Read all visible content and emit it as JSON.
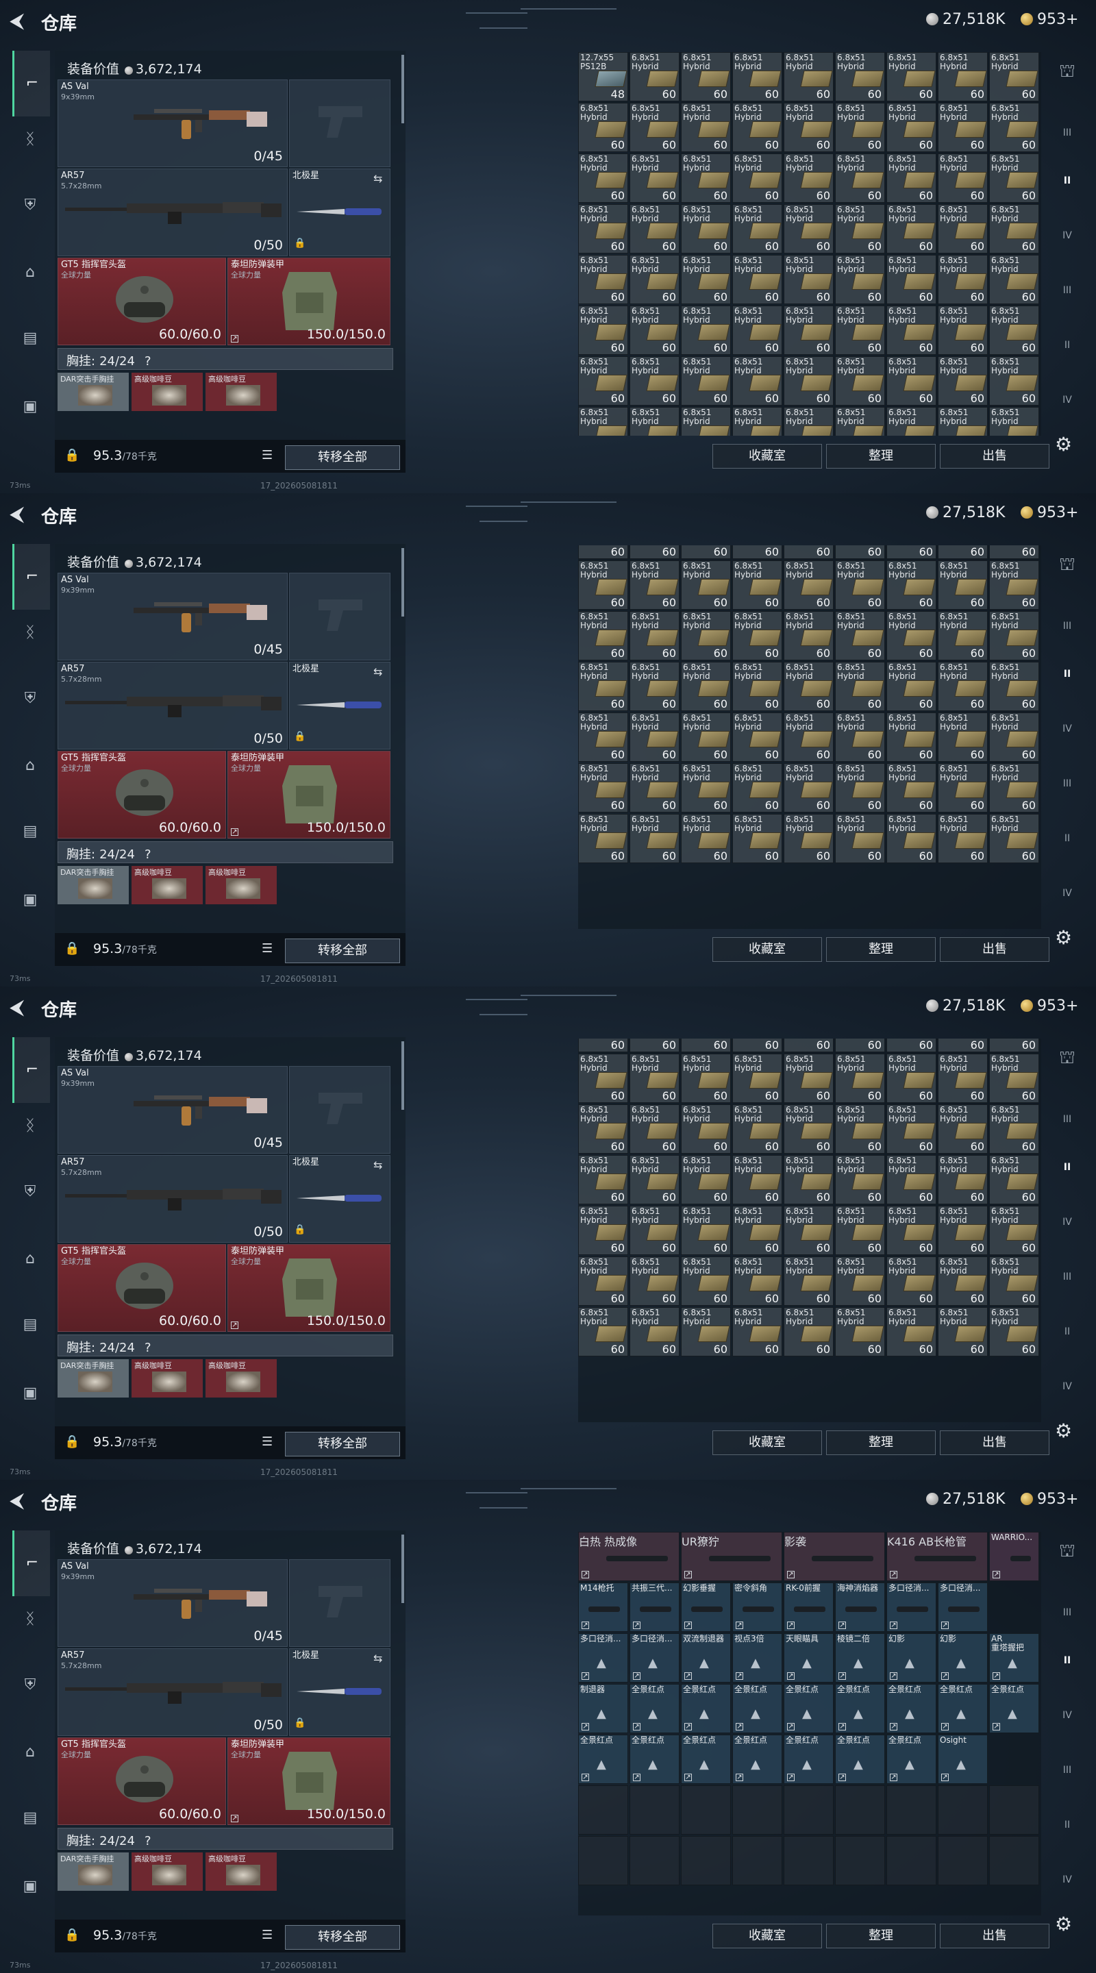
{
  "header": {
    "title": "仓库",
    "silver": "27,518K",
    "gold": "953+"
  },
  "gear": {
    "value_label": "装备价值",
    "value": "3,672,174",
    "primary": {
      "name": "AS Val",
      "caliber": "9x39mm",
      "ammo": "0/45"
    },
    "secondary": {
      "name": "AR57",
      "caliber": "5.7x28mm",
      "ammo": "0/50"
    },
    "melee": {
      "name": "北极星"
    },
    "helmet": {
      "name": "GT5 指挥官头盔",
      "brand": "全球力量",
      "durability": "60.0/60.0"
    },
    "armor": {
      "name": "泰坦防弹装甲",
      "brand": "全球力量",
      "durability": "150.0/150.0"
    },
    "chest_rig_label": "胸挂:",
    "chest_rig_value": "24/24",
    "chest_help": "?",
    "rig_items": [
      "DAR突击手胸挂",
      "高级咖啡豆",
      "高级咖啡豆"
    ],
    "weight": "95.3",
    "weight_max": "/78千克",
    "transfer_all": "转移全部"
  },
  "actions": {
    "collection": "收藏室",
    "sort": "整理",
    "sell": "出售"
  },
  "side_tabs": [
    "IV",
    "III",
    "II"
  ],
  "status": {
    "ping": "73ms",
    "version": "17_202605081811"
  },
  "ammo_label_a": "6.8x51",
  "ammo_label_b": "Hybrid",
  "ammo_count": "60",
  "first_cell": {
    "label_a": "12.7x55",
    "label_b": "PS12B",
    "count": "48"
  },
  "panel4": {
    "row1": [
      {
        "label": "白热 热成像",
        "cls": "purple"
      },
      {
        "label": "UR獠狞",
        "cls": "purple"
      },
      {
        "label": "影袭",
        "cls": "purple"
      },
      {
        "label": "K416\nAB长枪管",
        "cls": "purple"
      },
      {
        "label": "WARRIO...",
        "cls": "purple"
      }
    ],
    "row2": [
      "M14枪托",
      "共振三代...",
      "幻影垂握",
      "密令斜角",
      "RK-0前握",
      "海神消焰器",
      "多口径消...",
      "多口径消..."
    ],
    "row3": [
      "多口径消...",
      "多口径消...",
      "双流制退器",
      "视点3倍",
      "天眼瞄具",
      "棱镜二倍",
      "幻影",
      "幻影",
      "AR\n重塔握把"
    ],
    "row4": [
      "制退器",
      "全景红点",
      "全景红点",
      "全景红点",
      "全景红点",
      "全景红点",
      "全景红点",
      "全景红点",
      "全景红点"
    ],
    "row5": [
      "全景红点",
      "全景红点",
      "全景红点",
      "全景红点",
      "全景红点",
      "全景红点",
      "全景红点",
      "Osight"
    ]
  }
}
